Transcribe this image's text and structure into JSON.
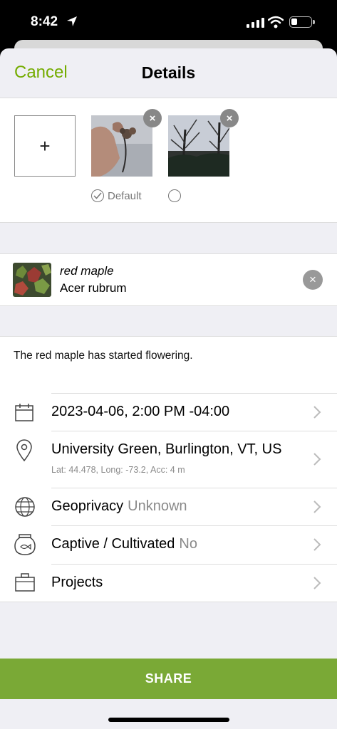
{
  "status_bar": {
    "time": "8:42"
  },
  "nav": {
    "cancel_label": "Cancel",
    "title": "Details"
  },
  "photos": {
    "add_symbol": "+",
    "remove_symbol": "×",
    "default_label": "Default",
    "selected_default_index": 0
  },
  "taxon": {
    "common_name": "red maple",
    "scientific_name": "Acer rubrum",
    "clear_symbol": "×"
  },
  "notes": "The red maple has started flowering.",
  "details": {
    "date": "2023-04-06, 2:00 PM -04:00",
    "location": {
      "place": "University Green, Burlington, VT, US",
      "coords": "Lat: 44.478, Long: -73.2, Acc: 4 m"
    },
    "geoprivacy": {
      "label": "Geoprivacy",
      "value": "Unknown"
    },
    "captive": {
      "label": "Captive / Cultivated",
      "value": "No"
    },
    "projects": {
      "label": "Projects"
    }
  },
  "share_label": "SHARE",
  "colors": {
    "accent": "#74ac00",
    "share_bg": "#7aa936",
    "muted": "#8a8a8a"
  }
}
